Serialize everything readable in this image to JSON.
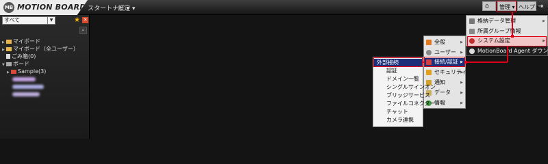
{
  "app": {
    "logo_badge": "MB",
    "logo_text": "MOTION BOARD"
  },
  "topbar": {
    "menu_startnavi": "スタートナビ ▾",
    "menu_settings": "設定 ▾",
    "menu_admin": "管理 ▾",
    "menu_help": "ヘルプ ▾"
  },
  "sidebar": {
    "filter_value": "すべて",
    "tree": [
      "マイボード",
      "マイボード（全ユーザー）",
      "ごみ箱(0)",
      "ボード",
      "Sample(3)"
    ]
  },
  "admin_menu": {
    "items": [
      "格納データ管理",
      "所属グループ情報",
      "システム設定",
      "MotionBoard Agent ダウンロード"
    ]
  },
  "system_menu": {
    "items": [
      "全般",
      "ユーザー",
      "接続/認証",
      "セキュリティ",
      "通知",
      "データ",
      "情報"
    ]
  },
  "connection_menu": {
    "items": [
      "外部接続",
      "認証",
      "ドメイン一覧",
      "シングルサインオン",
      "ブリッジサービス",
      "ファイルコネクター",
      "チャット",
      "カメラ連携"
    ]
  },
  "colors": {
    "highlight_red": "#e0001a",
    "highlight_blue": "#1c2f78",
    "highlight_pink": "#f2c6c6",
    "accent_gold": "#f2b200"
  }
}
